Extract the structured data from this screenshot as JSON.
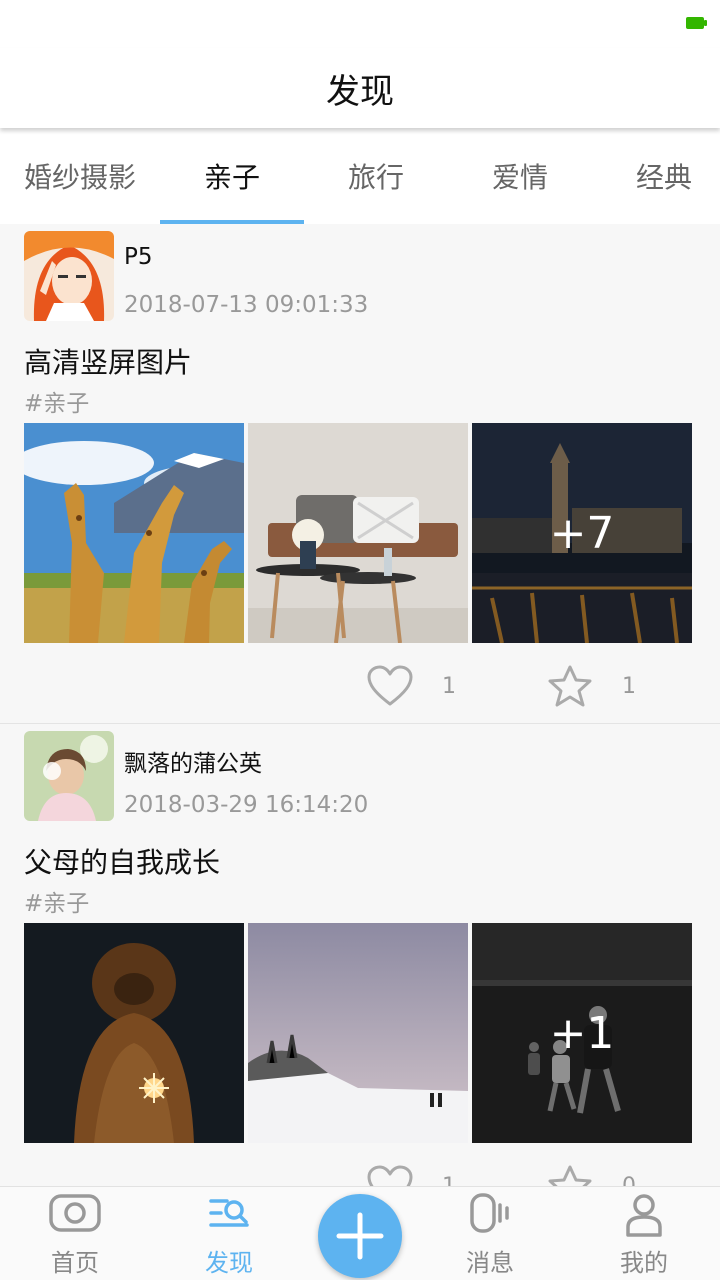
{
  "header": {
    "title": "发现"
  },
  "tabs": [
    {
      "label": "婚纱摄影"
    },
    {
      "label": "亲子",
      "active": true
    },
    {
      "label": "旅行"
    },
    {
      "label": "爱情"
    },
    {
      "label": "经典"
    }
  ],
  "posts": [
    {
      "username": "P5",
      "time": "2018-07-13 09:01:33",
      "title": "高清竖屏图片",
      "tag": "#亲子",
      "more_count": "+7",
      "likes": "1",
      "favorites": "1"
    },
    {
      "username": "飘落的蒲公英",
      "time": "2018-03-29 16:14:20",
      "title": "父母的自我成长",
      "tag": "#亲子",
      "more_count": "+1",
      "likes": "1",
      "favorites": "0"
    }
  ],
  "bottom_nav": {
    "items": [
      {
        "label": "首页",
        "icon": "camera-icon"
      },
      {
        "label": "发现",
        "icon": "discover-search-icon",
        "active": true
      },
      {
        "label": "消息",
        "icon": "message-icon"
      },
      {
        "label": "我的",
        "icon": "profile-icon"
      }
    ],
    "add_icon": "plus-icon"
  },
  "colors": {
    "accent": "#5db3f0",
    "battery": "#33b600"
  }
}
